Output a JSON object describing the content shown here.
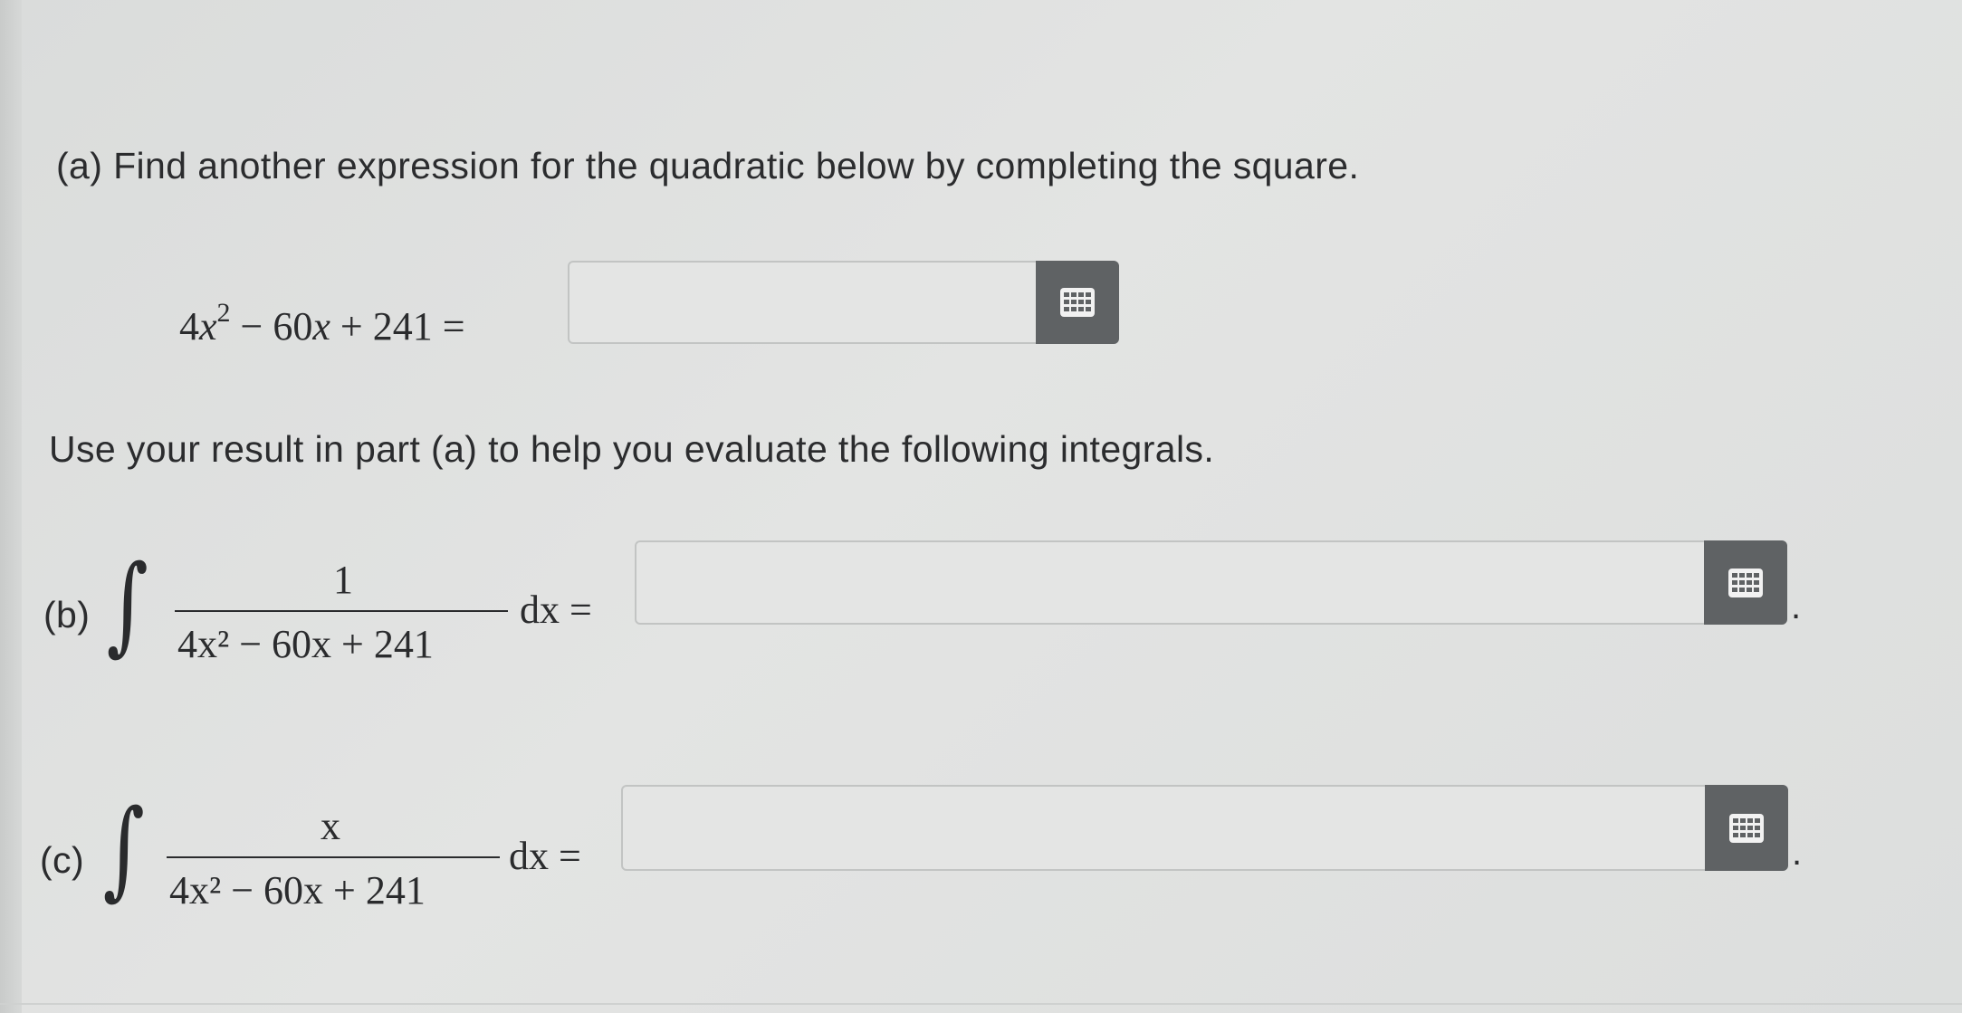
{
  "part_a": {
    "prompt": "(a) Find another expression for the quadratic below by completing the square.",
    "expression_coef": "4",
    "expression_var": "x",
    "expression_exp": "2",
    "expression_rest_1": " − 60",
    "expression_rest_var": "x",
    "expression_rest_2": " + 241 =",
    "answer_value": ""
  },
  "instruction": "Use your result in part (a) to help you evaluate the following integrals.",
  "part_b": {
    "label": "(b)",
    "integral_sign": "∫",
    "numerator": "1",
    "denominator": "4x² − 60x + 241",
    "differential": "dx =",
    "answer_value": "",
    "trailing": "."
  },
  "part_c": {
    "label": "(c)",
    "integral_sign": "∫",
    "numerator": "x",
    "denominator": "4x² − 60x + 241",
    "differential": "dx =",
    "answer_value": "",
    "trailing": "."
  },
  "icons": {
    "keypad": "keypad-grid-icon"
  },
  "colors": {
    "keypad_button": "#5f6264",
    "input_background": "#e4e5e4",
    "text": "#2b2c2e"
  }
}
